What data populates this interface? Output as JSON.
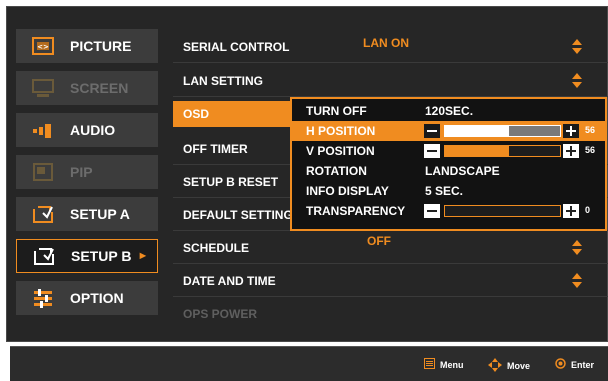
{
  "colors": {
    "accent": "#f08c20",
    "panel": "#262626",
    "item": "#3c3c3c"
  },
  "left_menu": {
    "items": [
      {
        "label": "PICTURE",
        "icon": "picture-icon",
        "state": "normal"
      },
      {
        "label": "SCREEN",
        "icon": "screen-icon",
        "state": "disabled"
      },
      {
        "label": "AUDIO",
        "icon": "audio-icon",
        "state": "normal"
      },
      {
        "label": "PIP",
        "icon": "pip-icon",
        "state": "disabled"
      },
      {
        "label": "SETUP A",
        "icon": "setup-icon",
        "state": "normal"
      },
      {
        "label": "SETUP B",
        "icon": "setup-icon",
        "state": "selected"
      },
      {
        "label": "OPTION",
        "icon": "option-icon",
        "state": "normal"
      }
    ],
    "selected_arrow": "►"
  },
  "settings": {
    "rows": [
      {
        "label": "SERIAL CONTROL",
        "value": "LAN ON",
        "updown": true
      },
      {
        "label": "LAN SETTING",
        "value": "",
        "updown": true
      },
      {
        "label": "OSD",
        "value": "",
        "updown": false,
        "selected": true
      },
      {
        "label": "OFF TIMER",
        "value": "",
        "updown": false
      },
      {
        "label": "SETUP B RESET",
        "value": "",
        "updown": false
      },
      {
        "label": "DEFAULT SETTING",
        "value": "",
        "updown": false
      },
      {
        "label": "SCHEDULE",
        "value": "OFF",
        "updown": true
      },
      {
        "label": "DATE AND TIME",
        "value": "",
        "updown": true
      },
      {
        "label": "OPS POWER",
        "value": "",
        "updown": false,
        "disabled": true
      }
    ]
  },
  "osd_submenu": {
    "turn_off": {
      "label": "TURN OFF",
      "value": "120SEC."
    },
    "h_position": {
      "label": "H POSITION",
      "value": "56",
      "fraction": 0.56
    },
    "v_position": {
      "label": "V POSITION",
      "value": "56",
      "fraction": 0.56
    },
    "rotation": {
      "label": "ROTATION",
      "value": "LANDSCAPE"
    },
    "info_display": {
      "label": "INFO DISPLAY",
      "value": "5 SEC."
    },
    "transparency": {
      "label": "TRANSPARENCY",
      "value": "0",
      "fraction": 0.0
    }
  },
  "legend": {
    "menu": "Menu",
    "move": "Move",
    "enter": "Enter"
  }
}
